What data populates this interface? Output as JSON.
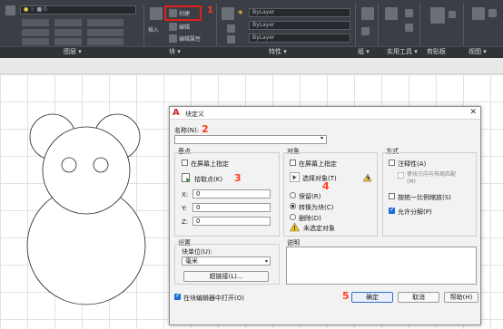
{
  "ribbon": {
    "layer_combo": "ByLayer",
    "color_combo": "ByLayer",
    "linetype_combo": "ByLayer",
    "lineweight_combo": "ByLayer",
    "panels": [
      {
        "label": "图层 ▾"
      },
      {
        "label": "块 ▾"
      },
      {
        "label": "特性 ▾"
      },
      {
        "label": "组 ▾"
      },
      {
        "label": "实用工具 ▾"
      },
      {
        "label": "剪贴板"
      },
      {
        "label": "视图 ▾"
      }
    ],
    "block_create_label": "创建",
    "block_edit_label": "编辑",
    "block_insert_label": "插入",
    "block_attr_label": "编辑属性"
  },
  "annotations": {
    "step1": "1",
    "step2": "2",
    "step3": "3",
    "step4": "4",
    "step5": "5"
  },
  "dialog": {
    "title": "块定义",
    "close": "✕",
    "name_label": "名称(N):",
    "name_value": "",
    "base_point": {
      "title": "基点",
      "specify_on_screen": "在屏幕上指定",
      "specify_on_screen_checked": false,
      "pick_point": "拾取点(K)",
      "x_label": "X:",
      "x_value": "0",
      "y_label": "Y:",
      "y_value": "0",
      "z_label": "Z:",
      "z_value": "0"
    },
    "objects": {
      "title": "对象",
      "specify_on_screen": "在屏幕上指定",
      "specify_on_screen_checked": false,
      "select_objects": "选择对象(T)",
      "retain": "保留(R)",
      "convert_to_block": "转换为块(C)",
      "delete": "删除(D)",
      "selected_radio": "convert_to_block",
      "warning": "未选定对象"
    },
    "behavior": {
      "title": "方式",
      "annotative": "注释性(A)",
      "annotative_checked": false,
      "match_orientation": "使块方向与布局匹配(M)",
      "scale_uniformly": "按统一比例缩放(S)",
      "scale_uniformly_checked": false,
      "allow_exploding": "允许分解(P)",
      "allow_exploding_checked": true
    },
    "settings": {
      "title": "设置",
      "block_unit_label": "块单位(U):",
      "block_unit_value": "毫米",
      "hyperlink": "超链接(L)..."
    },
    "description_label": "说明",
    "description_value": "",
    "open_in_editor": "在块编辑器中打开(O)",
    "open_in_editor_checked": true,
    "ok": "确定",
    "cancel": "取消",
    "help": "帮助(H)"
  }
}
